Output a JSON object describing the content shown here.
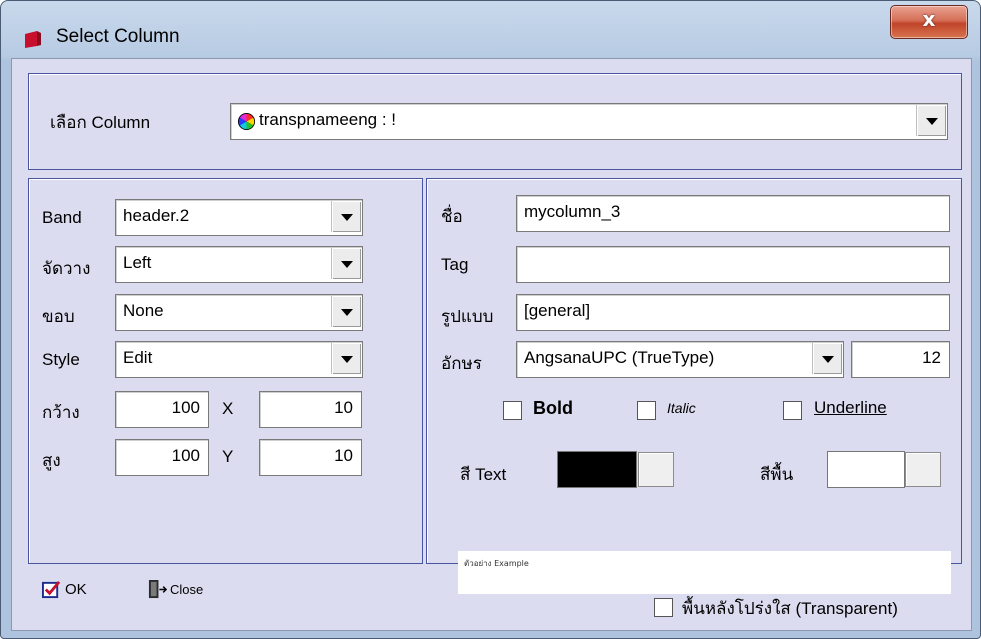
{
  "window": {
    "title": "Select Column",
    "close_label": "x"
  },
  "column_select": {
    "label": "เลือก Column",
    "value": "transpnameeng : !",
    "icon": "color-wheel-icon"
  },
  "left_panel": {
    "band": {
      "label": "Band",
      "value": "header.2"
    },
    "align": {
      "label": "จัดวาง",
      "value": "Left"
    },
    "border": {
      "label": "ขอบ",
      "value": "None"
    },
    "style": {
      "label": "Style",
      "value": "Edit"
    },
    "width": {
      "label": "กว้าง",
      "value": "100"
    },
    "x": {
      "label": "X",
      "value": "10"
    },
    "height": {
      "label": "สูง",
      "value": "100"
    },
    "y": {
      "label": "Y",
      "value": "10"
    }
  },
  "right_panel": {
    "name": {
      "label": "ชื่อ",
      "value": "mycolumn_3"
    },
    "tag": {
      "label": "Tag",
      "value": ""
    },
    "format": {
      "label": "รูปแบบ",
      "value": "[general]"
    },
    "font": {
      "label": "อักษร",
      "value": "AngsanaUPC (TrueType)",
      "size": "12"
    },
    "bold_label": "Bold",
    "italic_label": "Italic",
    "underline_label": "Underline",
    "text_color_label": "สี Text",
    "text_color": "#000000",
    "bg_color_label": "สีพื้น",
    "bg_color": "#ffffff",
    "preview_text": "ตัวอย่าง Example"
  },
  "footer": {
    "ok_label": "OK",
    "close_label": "Close",
    "transparent_label": "พื้นหลังโปร่งใส (Transparent)"
  }
}
